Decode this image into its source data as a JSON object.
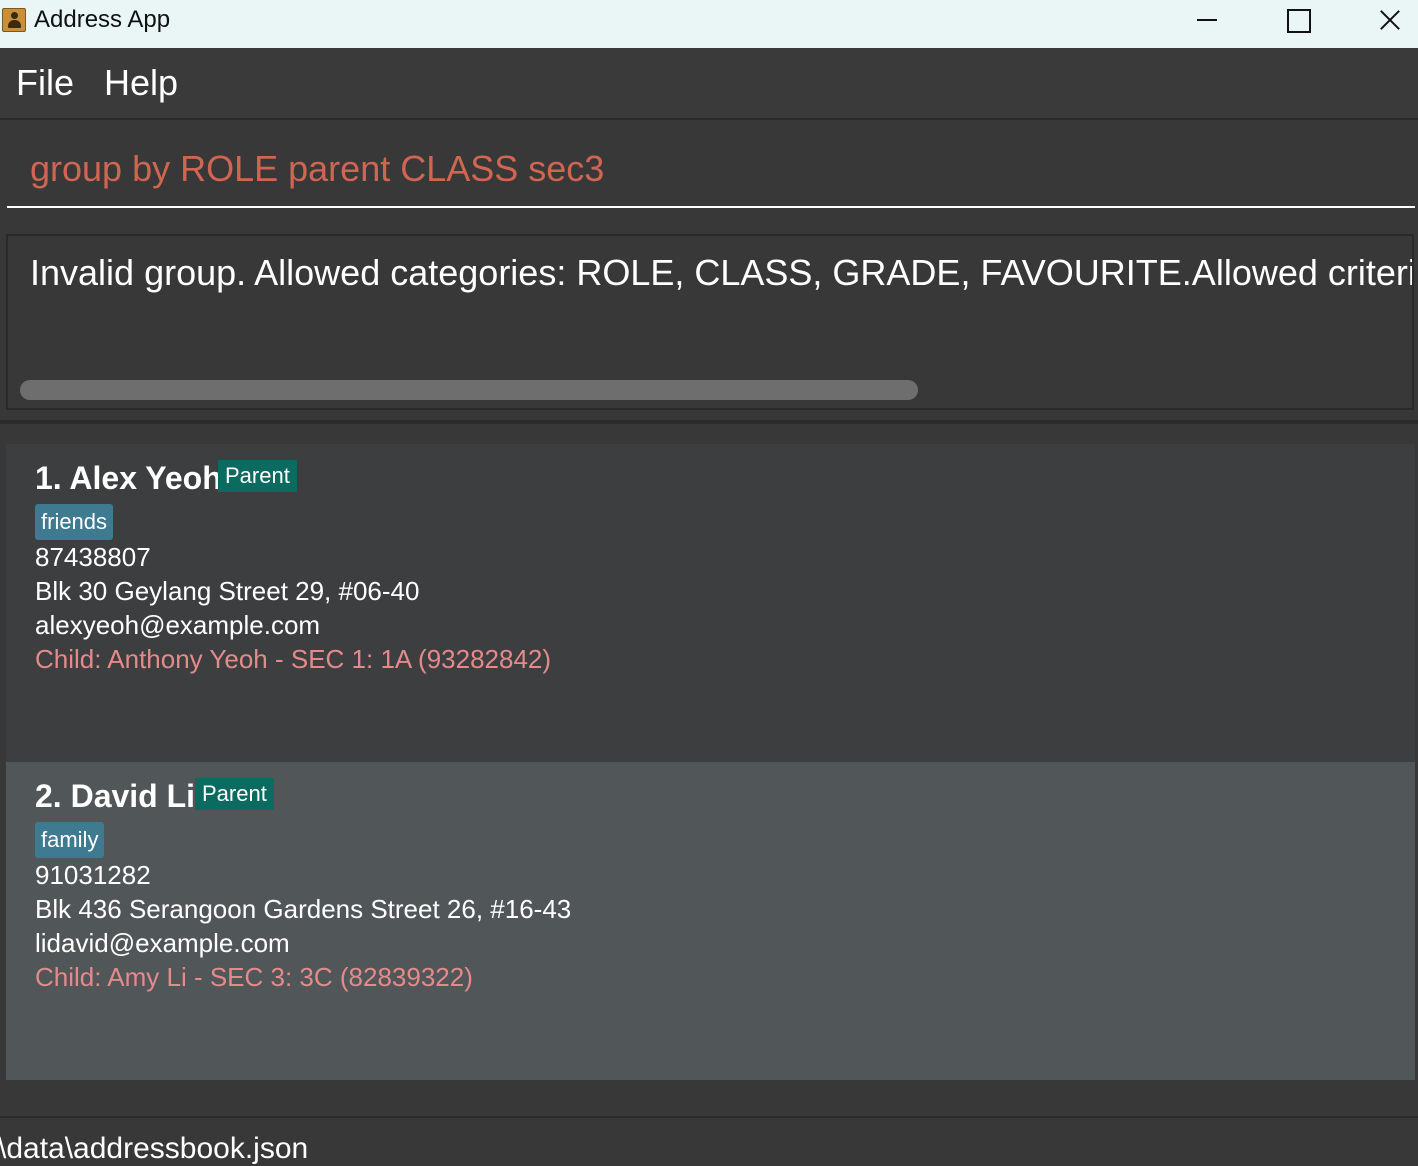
{
  "window": {
    "title": "Address App",
    "icon": "address-book-icon",
    "controls": [
      "minimize-icon",
      "maximize-icon",
      "close-icon"
    ]
  },
  "menu": {
    "file": "File",
    "help": "Help"
  },
  "command": {
    "value": "group by ROLE parent CLASS sec3",
    "color": "#d06651"
  },
  "result": {
    "text": "Invalid group. Allowed categories: ROLE, CLASS, GRADE, FAVOURITE.Allowed criteria: ROLE: Stu"
  },
  "persons": [
    {
      "name": "1. Alex Yeoh",
      "role": "Parent",
      "tag": "friends",
      "phone": "87438807",
      "address": "Blk 30 Geylang Street 29, #06-40",
      "email": "alexyeoh@example.com",
      "child": "Child: Anthony Yeoh - SEC 1: 1A (93282842)"
    },
    {
      "name": "2. David Li",
      "role": "Parent",
      "tag": "family",
      "phone": "91031282",
      "address": "Blk 436 Serangoon Gardens Street 26, #16-43",
      "email": "lidavid@example.com",
      "child": "Child: Amy Li - SEC 3: 3C (82839322)"
    }
  ],
  "status": {
    "path": "\\data\\addressbook.json"
  },
  "colors": {
    "role_badge": "#0c6b60",
    "tag": "#3e7b91",
    "child_text": "#e58a8a",
    "selected_card": "#515658"
  }
}
